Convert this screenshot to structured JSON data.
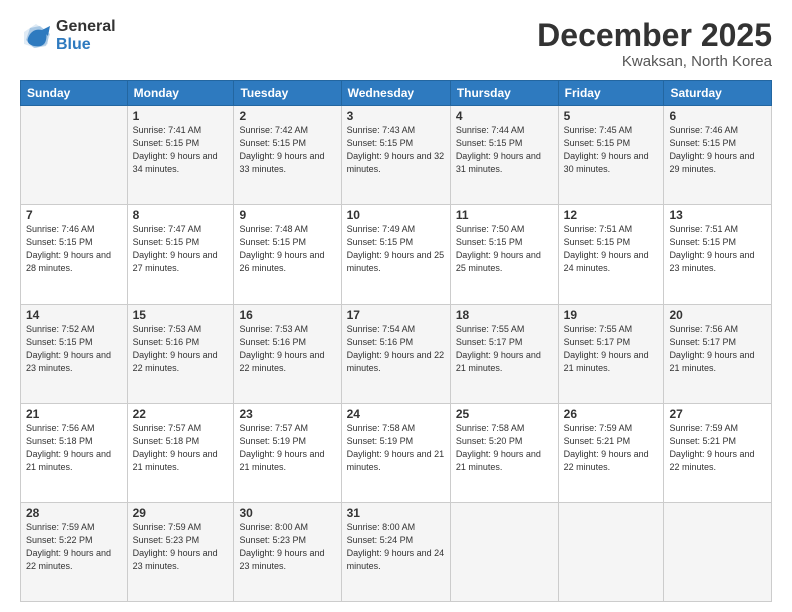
{
  "header": {
    "logo": {
      "general": "General",
      "blue": "Blue"
    },
    "title": "December 2025",
    "location": "Kwaksan, North Korea"
  },
  "weekdays": [
    "Sunday",
    "Monday",
    "Tuesday",
    "Wednesday",
    "Thursday",
    "Friday",
    "Saturday"
  ],
  "weeks": [
    [
      {
        "day": "",
        "sunrise": "",
        "sunset": "",
        "daylight": ""
      },
      {
        "day": "1",
        "sunrise": "Sunrise: 7:41 AM",
        "sunset": "Sunset: 5:15 PM",
        "daylight": "Daylight: 9 hours and 34 minutes."
      },
      {
        "day": "2",
        "sunrise": "Sunrise: 7:42 AM",
        "sunset": "Sunset: 5:15 PM",
        "daylight": "Daylight: 9 hours and 33 minutes."
      },
      {
        "day": "3",
        "sunrise": "Sunrise: 7:43 AM",
        "sunset": "Sunset: 5:15 PM",
        "daylight": "Daylight: 9 hours and 32 minutes."
      },
      {
        "day": "4",
        "sunrise": "Sunrise: 7:44 AM",
        "sunset": "Sunset: 5:15 PM",
        "daylight": "Daylight: 9 hours and 31 minutes."
      },
      {
        "day": "5",
        "sunrise": "Sunrise: 7:45 AM",
        "sunset": "Sunset: 5:15 PM",
        "daylight": "Daylight: 9 hours and 30 minutes."
      },
      {
        "day": "6",
        "sunrise": "Sunrise: 7:46 AM",
        "sunset": "Sunset: 5:15 PM",
        "daylight": "Daylight: 9 hours and 29 minutes."
      }
    ],
    [
      {
        "day": "7",
        "sunrise": "Sunrise: 7:46 AM",
        "sunset": "Sunset: 5:15 PM",
        "daylight": "Daylight: 9 hours and 28 minutes."
      },
      {
        "day": "8",
        "sunrise": "Sunrise: 7:47 AM",
        "sunset": "Sunset: 5:15 PM",
        "daylight": "Daylight: 9 hours and 27 minutes."
      },
      {
        "day": "9",
        "sunrise": "Sunrise: 7:48 AM",
        "sunset": "Sunset: 5:15 PM",
        "daylight": "Daylight: 9 hours and 26 minutes."
      },
      {
        "day": "10",
        "sunrise": "Sunrise: 7:49 AM",
        "sunset": "Sunset: 5:15 PM",
        "daylight": "Daylight: 9 hours and 25 minutes."
      },
      {
        "day": "11",
        "sunrise": "Sunrise: 7:50 AM",
        "sunset": "Sunset: 5:15 PM",
        "daylight": "Daylight: 9 hours and 25 minutes."
      },
      {
        "day": "12",
        "sunrise": "Sunrise: 7:51 AM",
        "sunset": "Sunset: 5:15 PM",
        "daylight": "Daylight: 9 hours and 24 minutes."
      },
      {
        "day": "13",
        "sunrise": "Sunrise: 7:51 AM",
        "sunset": "Sunset: 5:15 PM",
        "daylight": "Daylight: 9 hours and 23 minutes."
      }
    ],
    [
      {
        "day": "14",
        "sunrise": "Sunrise: 7:52 AM",
        "sunset": "Sunset: 5:15 PM",
        "daylight": "Daylight: 9 hours and 23 minutes."
      },
      {
        "day": "15",
        "sunrise": "Sunrise: 7:53 AM",
        "sunset": "Sunset: 5:16 PM",
        "daylight": "Daylight: 9 hours and 22 minutes."
      },
      {
        "day": "16",
        "sunrise": "Sunrise: 7:53 AM",
        "sunset": "Sunset: 5:16 PM",
        "daylight": "Daylight: 9 hours and 22 minutes."
      },
      {
        "day": "17",
        "sunrise": "Sunrise: 7:54 AM",
        "sunset": "Sunset: 5:16 PM",
        "daylight": "Daylight: 9 hours and 22 minutes."
      },
      {
        "day": "18",
        "sunrise": "Sunrise: 7:55 AM",
        "sunset": "Sunset: 5:17 PM",
        "daylight": "Daylight: 9 hours and 21 minutes."
      },
      {
        "day": "19",
        "sunrise": "Sunrise: 7:55 AM",
        "sunset": "Sunset: 5:17 PM",
        "daylight": "Daylight: 9 hours and 21 minutes."
      },
      {
        "day": "20",
        "sunrise": "Sunrise: 7:56 AM",
        "sunset": "Sunset: 5:17 PM",
        "daylight": "Daylight: 9 hours and 21 minutes."
      }
    ],
    [
      {
        "day": "21",
        "sunrise": "Sunrise: 7:56 AM",
        "sunset": "Sunset: 5:18 PM",
        "daylight": "Daylight: 9 hours and 21 minutes."
      },
      {
        "day": "22",
        "sunrise": "Sunrise: 7:57 AM",
        "sunset": "Sunset: 5:18 PM",
        "daylight": "Daylight: 9 hours and 21 minutes."
      },
      {
        "day": "23",
        "sunrise": "Sunrise: 7:57 AM",
        "sunset": "Sunset: 5:19 PM",
        "daylight": "Daylight: 9 hours and 21 minutes."
      },
      {
        "day": "24",
        "sunrise": "Sunrise: 7:58 AM",
        "sunset": "Sunset: 5:19 PM",
        "daylight": "Daylight: 9 hours and 21 minutes."
      },
      {
        "day": "25",
        "sunrise": "Sunrise: 7:58 AM",
        "sunset": "Sunset: 5:20 PM",
        "daylight": "Daylight: 9 hours and 21 minutes."
      },
      {
        "day": "26",
        "sunrise": "Sunrise: 7:59 AM",
        "sunset": "Sunset: 5:21 PM",
        "daylight": "Daylight: 9 hours and 22 minutes."
      },
      {
        "day": "27",
        "sunrise": "Sunrise: 7:59 AM",
        "sunset": "Sunset: 5:21 PM",
        "daylight": "Daylight: 9 hours and 22 minutes."
      }
    ],
    [
      {
        "day": "28",
        "sunrise": "Sunrise: 7:59 AM",
        "sunset": "Sunset: 5:22 PM",
        "daylight": "Daylight: 9 hours and 22 minutes."
      },
      {
        "day": "29",
        "sunrise": "Sunrise: 7:59 AM",
        "sunset": "Sunset: 5:23 PM",
        "daylight": "Daylight: 9 hours and 23 minutes."
      },
      {
        "day": "30",
        "sunrise": "Sunrise: 8:00 AM",
        "sunset": "Sunset: 5:23 PM",
        "daylight": "Daylight: 9 hours and 23 minutes."
      },
      {
        "day": "31",
        "sunrise": "Sunrise: 8:00 AM",
        "sunset": "Sunset: 5:24 PM",
        "daylight": "Daylight: 9 hours and 24 minutes."
      },
      {
        "day": "",
        "sunrise": "",
        "sunset": "",
        "daylight": ""
      },
      {
        "day": "",
        "sunrise": "",
        "sunset": "",
        "daylight": ""
      },
      {
        "day": "",
        "sunrise": "",
        "sunset": "",
        "daylight": ""
      }
    ]
  ]
}
